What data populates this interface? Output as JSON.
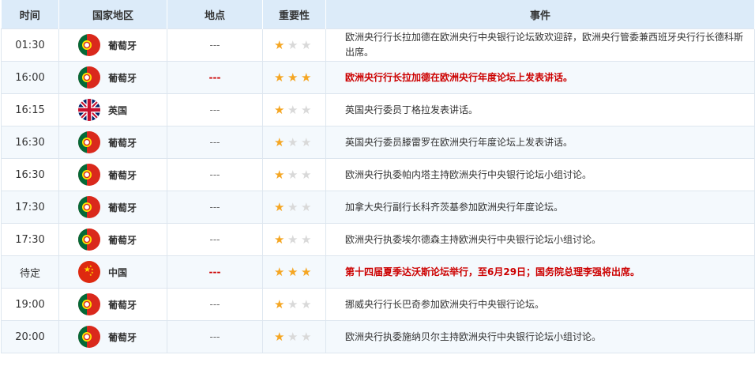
{
  "headers": {
    "time": "时间",
    "country": "国家地区",
    "location": "地点",
    "importance": "重要性",
    "event": "事件"
  },
  "rows": [
    {
      "time": "01:30",
      "flag": "portugal-flag-icon",
      "country": "葡萄牙",
      "location": "---",
      "stars": 1,
      "event": "欧洲央行行长拉加德在欧洲央行中央银行论坛致欢迎辞，欧洲央行管委兼西班牙央行行长德科斯出席。",
      "high": false
    },
    {
      "time": "16:00",
      "flag": "portugal-flag-icon",
      "country": "葡萄牙",
      "location": "---",
      "stars": 3,
      "event": "欧洲央行行长拉加德在欧洲央行年度论坛上发表讲话。",
      "high": true
    },
    {
      "time": "16:15",
      "flag": "uk-flag-icon",
      "country": "英国",
      "location": "---",
      "stars": 1,
      "event": "英国央行委员丁格拉发表讲话。",
      "high": false
    },
    {
      "time": "16:30",
      "flag": "portugal-flag-icon",
      "country": "葡萄牙",
      "location": "---",
      "stars": 1,
      "event": "英国央行委员滕雷罗在欧洲央行年度论坛上发表讲话。",
      "high": false
    },
    {
      "time": "16:30",
      "flag": "portugal-flag-icon",
      "country": "葡萄牙",
      "location": "---",
      "stars": 1,
      "event": "欧洲央行执委帕内塔主持欧洲央行中央银行论坛小组讨论。",
      "high": false
    },
    {
      "time": "17:30",
      "flag": "portugal-flag-icon",
      "country": "葡萄牙",
      "location": "---",
      "stars": 1,
      "event": "加拿大央行副行长科齐茨基参加欧洲央行年度论坛。",
      "high": false
    },
    {
      "time": "17:30",
      "flag": "portugal-flag-icon",
      "country": "葡萄牙",
      "location": "---",
      "stars": 1,
      "event": "欧洲央行执委埃尔德森主持欧洲央行中央银行论坛小组讨论。",
      "high": false
    },
    {
      "time": "待定",
      "flag": "china-flag-icon",
      "country": "中国",
      "location": "---",
      "stars": 3,
      "event": "第十四届夏季达沃斯论坛举行，至6月29日；国务院总理李强将出席。",
      "high": true
    },
    {
      "time": "19:00",
      "flag": "portugal-flag-icon",
      "country": "葡萄牙",
      "location": "---",
      "stars": 1,
      "event": "挪威央行行长巴奇参加欧洲央行中央银行论坛。",
      "high": false
    },
    {
      "time": "20:00",
      "flag": "portugal-flag-icon",
      "country": "葡萄牙",
      "location": "---",
      "stars": 1,
      "event": "欧洲央行执委施纳贝尔主持欧洲央行中央银行论坛小组讨论。",
      "high": false
    }
  ],
  "colors": {
    "header_bg": "#dcebf9",
    "alt_row_bg": "#f4f9fd",
    "star_on": "#f5a623",
    "star_off": "#d9d9d9",
    "high_text": "#cc0000"
  }
}
